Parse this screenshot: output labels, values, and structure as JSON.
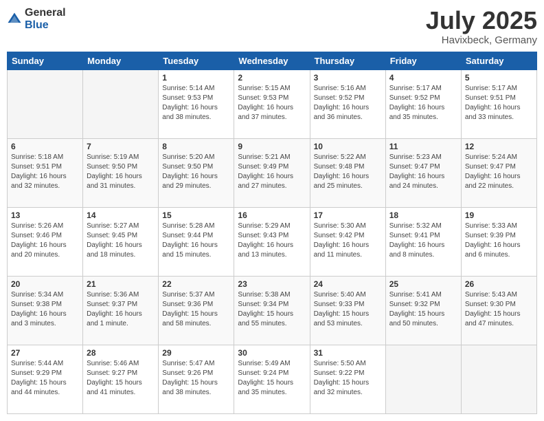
{
  "logo": {
    "general": "General",
    "blue": "Blue"
  },
  "header": {
    "month": "July 2025",
    "location": "Havixbeck, Germany"
  },
  "weekdays": [
    "Sunday",
    "Monday",
    "Tuesday",
    "Wednesday",
    "Thursday",
    "Friday",
    "Saturday"
  ],
  "weeks": [
    [
      {
        "day": "",
        "info": ""
      },
      {
        "day": "",
        "info": ""
      },
      {
        "day": "1",
        "info": "Sunrise: 5:14 AM\nSunset: 9:53 PM\nDaylight: 16 hours\nand 38 minutes."
      },
      {
        "day": "2",
        "info": "Sunrise: 5:15 AM\nSunset: 9:53 PM\nDaylight: 16 hours\nand 37 minutes."
      },
      {
        "day": "3",
        "info": "Sunrise: 5:16 AM\nSunset: 9:52 PM\nDaylight: 16 hours\nand 36 minutes."
      },
      {
        "day": "4",
        "info": "Sunrise: 5:17 AM\nSunset: 9:52 PM\nDaylight: 16 hours\nand 35 minutes."
      },
      {
        "day": "5",
        "info": "Sunrise: 5:17 AM\nSunset: 9:51 PM\nDaylight: 16 hours\nand 33 minutes."
      }
    ],
    [
      {
        "day": "6",
        "info": "Sunrise: 5:18 AM\nSunset: 9:51 PM\nDaylight: 16 hours\nand 32 minutes."
      },
      {
        "day": "7",
        "info": "Sunrise: 5:19 AM\nSunset: 9:50 PM\nDaylight: 16 hours\nand 31 minutes."
      },
      {
        "day": "8",
        "info": "Sunrise: 5:20 AM\nSunset: 9:50 PM\nDaylight: 16 hours\nand 29 minutes."
      },
      {
        "day": "9",
        "info": "Sunrise: 5:21 AM\nSunset: 9:49 PM\nDaylight: 16 hours\nand 27 minutes."
      },
      {
        "day": "10",
        "info": "Sunrise: 5:22 AM\nSunset: 9:48 PM\nDaylight: 16 hours\nand 25 minutes."
      },
      {
        "day": "11",
        "info": "Sunrise: 5:23 AM\nSunset: 9:47 PM\nDaylight: 16 hours\nand 24 minutes."
      },
      {
        "day": "12",
        "info": "Sunrise: 5:24 AM\nSunset: 9:47 PM\nDaylight: 16 hours\nand 22 minutes."
      }
    ],
    [
      {
        "day": "13",
        "info": "Sunrise: 5:26 AM\nSunset: 9:46 PM\nDaylight: 16 hours\nand 20 minutes."
      },
      {
        "day": "14",
        "info": "Sunrise: 5:27 AM\nSunset: 9:45 PM\nDaylight: 16 hours\nand 18 minutes."
      },
      {
        "day": "15",
        "info": "Sunrise: 5:28 AM\nSunset: 9:44 PM\nDaylight: 16 hours\nand 15 minutes."
      },
      {
        "day": "16",
        "info": "Sunrise: 5:29 AM\nSunset: 9:43 PM\nDaylight: 16 hours\nand 13 minutes."
      },
      {
        "day": "17",
        "info": "Sunrise: 5:30 AM\nSunset: 9:42 PM\nDaylight: 16 hours\nand 11 minutes."
      },
      {
        "day": "18",
        "info": "Sunrise: 5:32 AM\nSunset: 9:41 PM\nDaylight: 16 hours\nand 8 minutes."
      },
      {
        "day": "19",
        "info": "Sunrise: 5:33 AM\nSunset: 9:39 PM\nDaylight: 16 hours\nand 6 minutes."
      }
    ],
    [
      {
        "day": "20",
        "info": "Sunrise: 5:34 AM\nSunset: 9:38 PM\nDaylight: 16 hours\nand 3 minutes."
      },
      {
        "day": "21",
        "info": "Sunrise: 5:36 AM\nSunset: 9:37 PM\nDaylight: 16 hours\nand 1 minute."
      },
      {
        "day": "22",
        "info": "Sunrise: 5:37 AM\nSunset: 9:36 PM\nDaylight: 15 hours\nand 58 minutes."
      },
      {
        "day": "23",
        "info": "Sunrise: 5:38 AM\nSunset: 9:34 PM\nDaylight: 15 hours\nand 55 minutes."
      },
      {
        "day": "24",
        "info": "Sunrise: 5:40 AM\nSunset: 9:33 PM\nDaylight: 15 hours\nand 53 minutes."
      },
      {
        "day": "25",
        "info": "Sunrise: 5:41 AM\nSunset: 9:32 PM\nDaylight: 15 hours\nand 50 minutes."
      },
      {
        "day": "26",
        "info": "Sunrise: 5:43 AM\nSunset: 9:30 PM\nDaylight: 15 hours\nand 47 minutes."
      }
    ],
    [
      {
        "day": "27",
        "info": "Sunrise: 5:44 AM\nSunset: 9:29 PM\nDaylight: 15 hours\nand 44 minutes."
      },
      {
        "day": "28",
        "info": "Sunrise: 5:46 AM\nSunset: 9:27 PM\nDaylight: 15 hours\nand 41 minutes."
      },
      {
        "day": "29",
        "info": "Sunrise: 5:47 AM\nSunset: 9:26 PM\nDaylight: 15 hours\nand 38 minutes."
      },
      {
        "day": "30",
        "info": "Sunrise: 5:49 AM\nSunset: 9:24 PM\nDaylight: 15 hours\nand 35 minutes."
      },
      {
        "day": "31",
        "info": "Sunrise: 5:50 AM\nSunset: 9:22 PM\nDaylight: 15 hours\nand 32 minutes."
      },
      {
        "day": "",
        "info": ""
      },
      {
        "day": "",
        "info": ""
      }
    ]
  ]
}
